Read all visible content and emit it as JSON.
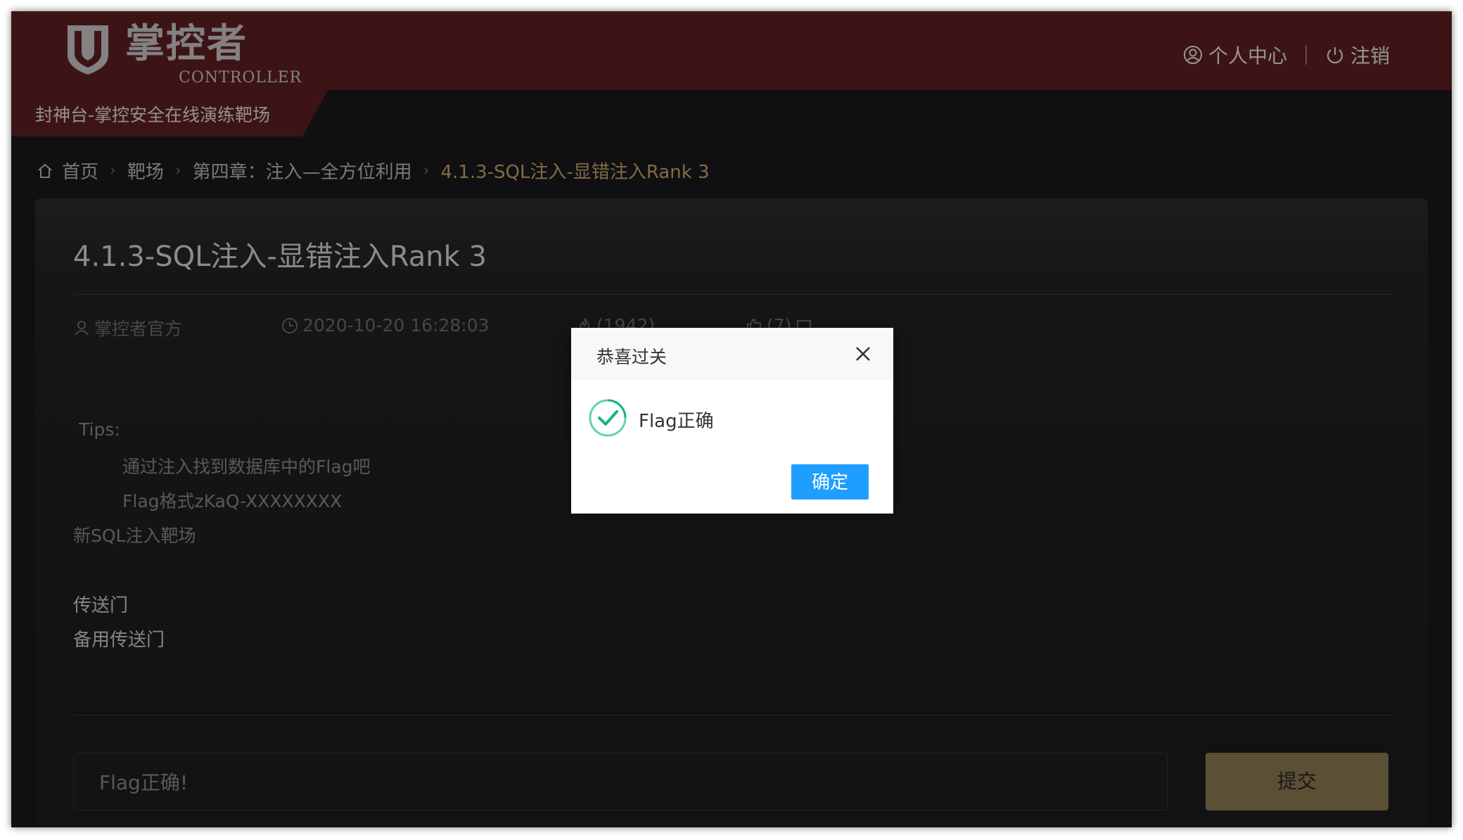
{
  "header": {
    "logo_text": "掌控者",
    "logo_sub": "CONTROLLER",
    "personal_center": "个人中心",
    "logout": "注销",
    "site_title": "封神台-掌控安全在线演练靶场"
  },
  "breadcrumb": {
    "home": "首页",
    "range": "靶场",
    "chapter": "第四章：注入—全方位利用",
    "current": "4.1.3-SQL注入-显错注入Rank 3"
  },
  "card": {
    "title": "4.1.3-SQL注入-显错注入Rank 3",
    "author": "掌控者官方",
    "date": "2020-10-20 16:28:03",
    "views": "(1942)",
    "likes": "(7)",
    "tips_label": "Tips:",
    "tip1": "通过注入找到数据库中的Flag吧",
    "tip2": "Flag格式zKaQ-XXXXXXXX",
    "range_name": "新SQL注入靶场",
    "portal": "传送门",
    "backup_portal": "备用传送门",
    "flag_input_value": "Flag正确!",
    "submit": "提交"
  },
  "modal": {
    "title": "恭喜过关",
    "message": "Flag正确",
    "ok": "确定"
  },
  "colors": {
    "header_bg": "#5e1f22",
    "accent_gold": "#c8a56a",
    "submit_bg": "#8c7b54",
    "modal_ok": "#1e9fff",
    "success_green": "#16b777"
  }
}
